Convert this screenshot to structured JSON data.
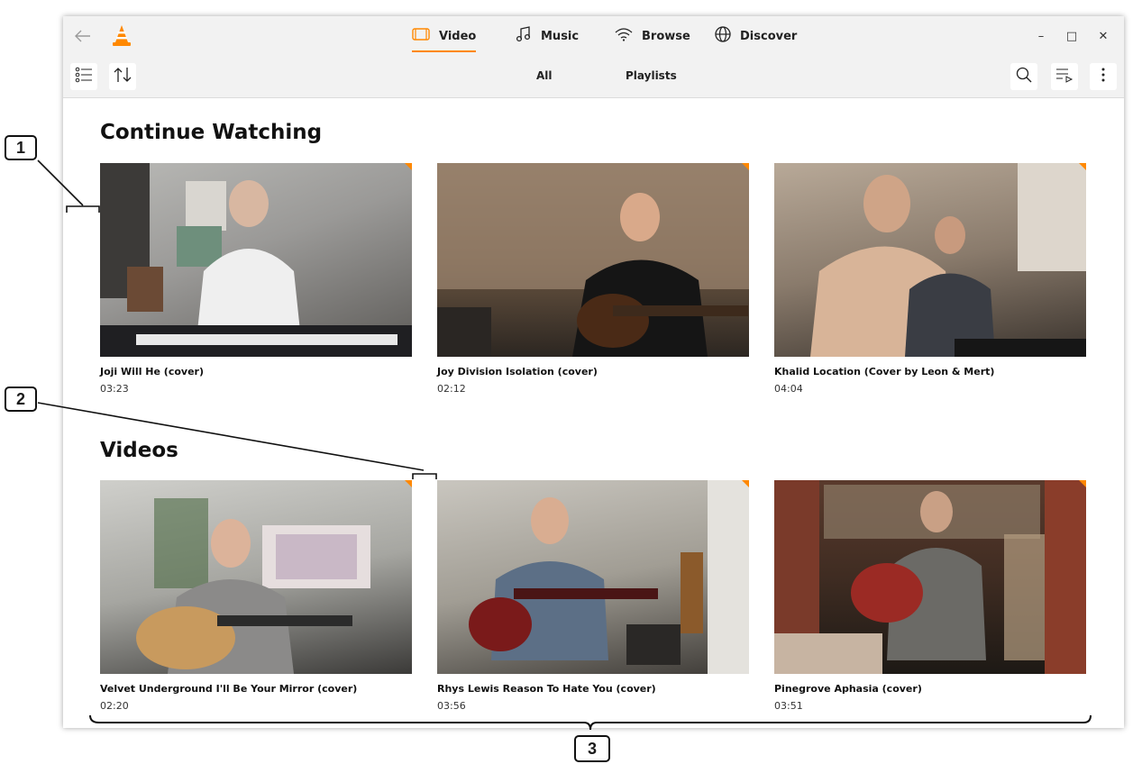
{
  "nav": {
    "video": "Video",
    "music": "Music",
    "browse": "Browse",
    "discover": "Discover"
  },
  "subtabs": {
    "all": "All",
    "playlists": "Playlists"
  },
  "window_controls": {
    "minimize": "–",
    "maximize": "□",
    "close": "✕"
  },
  "sections": {
    "continue": {
      "title": "Continue Watching",
      "items": [
        {
          "title": "Joji Will He (cover)",
          "duration": "03:23"
        },
        {
          "title": "Joy Division Isolation (cover)",
          "duration": "02:12"
        },
        {
          "title": "Khalid Location (Cover by Leon & Mert)",
          "duration": "04:04"
        }
      ]
    },
    "videos": {
      "title": "Videos",
      "items": [
        {
          "title": "Velvet Underground I'll Be Your Mirror (cover)",
          "duration": "02:20"
        },
        {
          "title": "Rhys Lewis Reason To Hate You (cover)",
          "duration": "03:56"
        },
        {
          "title": "Pinegrove Aphasia (cover)",
          "duration": "03:51"
        }
      ]
    }
  },
  "callouts": [
    "1",
    "2",
    "3"
  ],
  "colors": {
    "accent": "#ff8800",
    "chrome": "#f2f2f2"
  }
}
